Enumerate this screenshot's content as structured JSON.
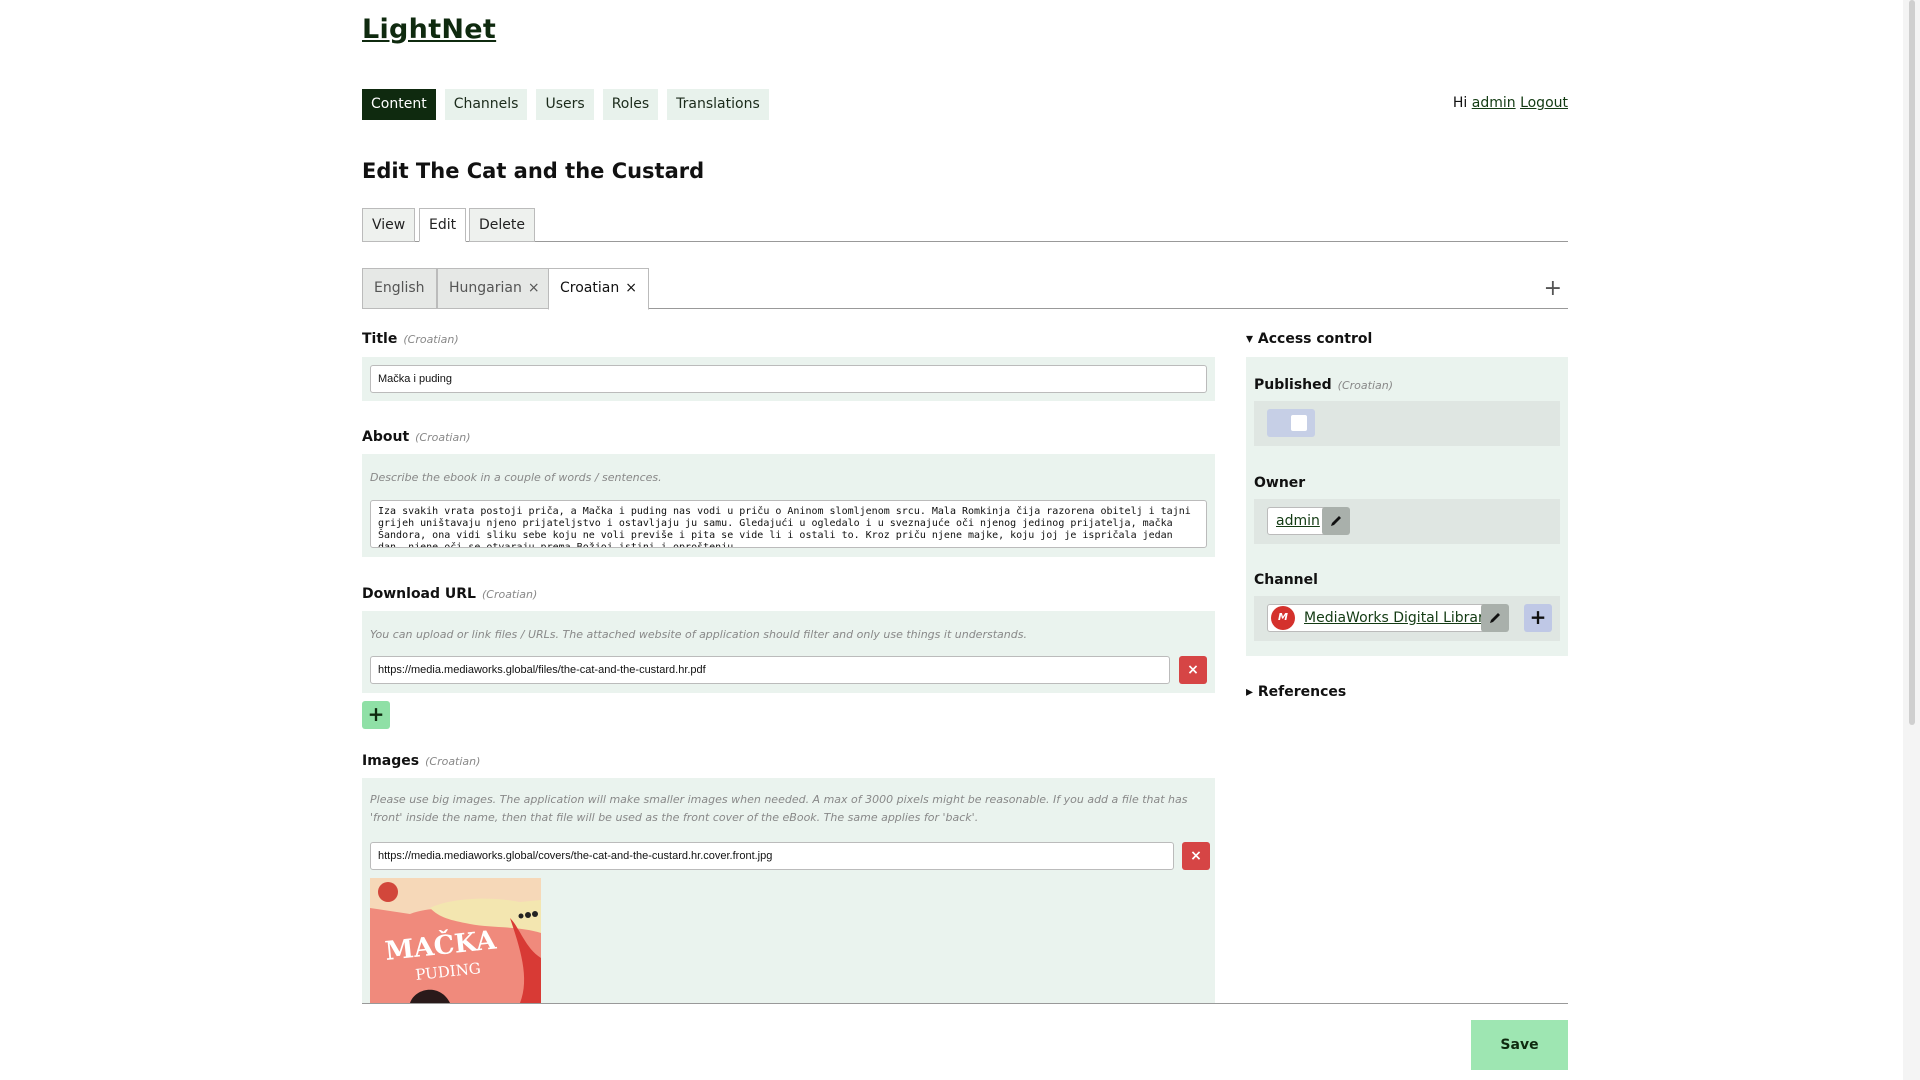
{
  "app": {
    "logo": "LightNet"
  },
  "nav": {
    "items": [
      {
        "label": "Content",
        "active": true
      },
      {
        "label": "Channels",
        "active": false
      },
      {
        "label": "Users",
        "active": false
      },
      {
        "label": "Roles",
        "active": false
      },
      {
        "label": "Translations",
        "active": false
      }
    ]
  },
  "user": {
    "greeting": "Hi",
    "name": "admin",
    "logout": "Logout"
  },
  "page": {
    "title": "Edit The Cat and the Custard"
  },
  "view_tabs": [
    "View",
    "Edit",
    "Delete"
  ],
  "lang_tabs": [
    {
      "label": "English",
      "closable": false
    },
    {
      "label": "Hungarian",
      "closable": true,
      "close": "×"
    },
    {
      "label": "Croatian",
      "closable": true,
      "close": "×",
      "active": true
    }
  ],
  "lang_add": "+",
  "form": {
    "title": {
      "label": "Title",
      "lang": "(Croatian)",
      "value": "Mačka i puding"
    },
    "about": {
      "label": "About",
      "lang": "(Croatian)",
      "hint": "Describe the ebook in a couple of words / sentences.",
      "value": "Iza svakih vrata postoji priča, a Mačka i puding nas vodi u priču o Aninom slomljenom srcu. Mala Romkinja čija razorena obitelj i tajni grijeh uništavaju njeno prijateljstvo i ostavljaju ju samu. Gledajući u ogledalo i u sveznajuće oči njenog jedinog prijatelja, mačka Šandora, ona vidi sliku sebe koju ne voli previše i pita se vide li i ostali to. Kroz priču njene majke, koju joj je ispričala jedan dan, njene oči se otvaraju prema Božjoj istini i oproštenju."
    },
    "download": {
      "label": "Download URL",
      "lang": "(Croatian)",
      "hint": "You can upload or link files / URLs. The attached website of application should filter and only use things it understands.",
      "value": "https://media.mediaworks.global/files/the-cat-and-the-custard.hr.pdf",
      "remove": "×",
      "add": "+"
    },
    "images": {
      "label": "Images",
      "lang": "(Croatian)",
      "hint": "Please use big images. The application will make smaller images when needed. A max of 3000 pixels might be reasonable. If you add a file that has 'front' inside the name, then that file will be used as the front cover of the eBook. The same applies for 'back'.",
      "value": "https://media.mediaworks.global/covers/the-cat-and-the-custard.hr.cover.front.jpg",
      "remove": "×",
      "cover_title": "MAČKA",
      "cover_sub": "PUDING"
    }
  },
  "sidebar": {
    "access_control": "▾ Access control",
    "published": {
      "label": "Published",
      "lang": "(Croatian)",
      "checked": false
    },
    "owner": {
      "label": "Owner",
      "value": "admin"
    },
    "channel": {
      "label": "Channel",
      "value": "MediaWorks Digital Library",
      "avatar_text": "M"
    },
    "references": "▸ References"
  },
  "actions": {
    "save": "Save"
  },
  "colors": {
    "brand_dark": "#0f2a0f",
    "panel": "#eaf3ee",
    "danger": "#d64545",
    "save": "#9ee6b2"
  },
  "icons": {
    "edit": "pencil-icon",
    "add": "plus-icon",
    "remove": "close-icon"
  }
}
